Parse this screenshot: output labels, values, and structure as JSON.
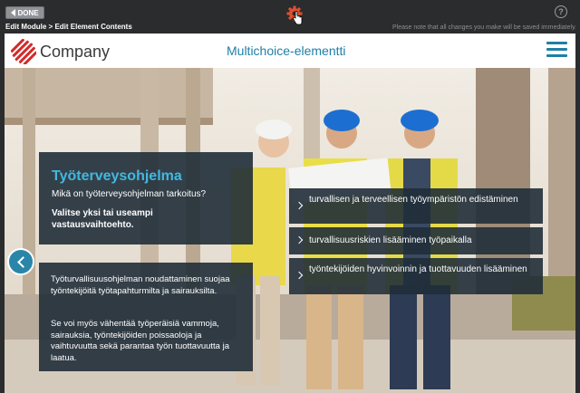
{
  "editor": {
    "done_label": "DONE",
    "breadcrumb": "Edit Module > Edit Element Contents",
    "save_note": "Please note that all changes you make will be saved immediately.",
    "help_glyph": "?"
  },
  "header": {
    "logo_text": "Company",
    "module_title": "Multichoice-elementti"
  },
  "question": {
    "title": "Työterveysohjelma",
    "subtitle": "Mikä on työterveysohjelman tarkoitus?",
    "instruction": "Valitse yksi tai useampi vastausvaihtoehto."
  },
  "info": {
    "paragraph1": "Työturvallisuusohjelman noudattaminen suojaa työntekijöitä työtapahturmilta ja sairauksilta.",
    "paragraph2": "Se voi myös vähentää työperäisiä vammoja, sairauksia, työntekijöiden poissaoloja ja vaihtuvuutta sekä parantaa työn tuottavuutta ja laatua."
  },
  "options": [
    {
      "label": "turvallisen ja terveellisen työympäristön edistäminen"
    },
    {
      "label": "turvallisuusriskien lisääminen työpaikalla"
    },
    {
      "label": "työntekijöiden hyvinvoinnin ja tuottavuuden lisääminen"
    }
  ],
  "colors": {
    "accent": "#1e7fa6",
    "panel_bg": "#202d38",
    "title_blue": "#42b8e0",
    "brand_red": "#d42a2a",
    "editor_bg": "#2b2c2e"
  }
}
